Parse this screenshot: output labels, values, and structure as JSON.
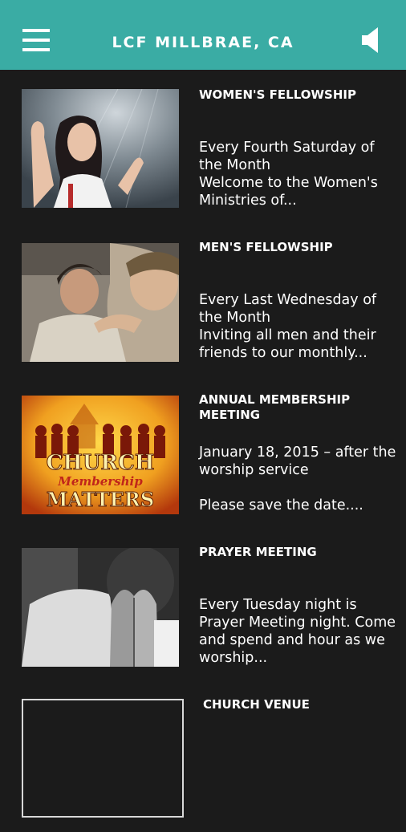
{
  "header": {
    "title": "LCF MILLBRAE, CA",
    "menu_icon": "hamburger-menu-icon",
    "sound_icon": "speaker-icon",
    "background_color": "#3aaca4"
  },
  "events": [
    {
      "title": "WOMEN'S FELLOWSHIP",
      "description": "Every Fourth Saturday of the Month\nWelcome to the Women's Ministries of..."
    },
    {
      "title": "MEN'S FELLOWSHIP",
      "description": "Every Last Wednesday of the Month\nInviting all men and their friends to our monthly..."
    },
    {
      "title": "ANNUAL MEMBERSHIP MEETING",
      "description": "January 18, 2015 – after the worship service\n\nPlease save the date....",
      "image_text": [
        "CHURCH",
        "Membership",
        "MATTERS"
      ]
    },
    {
      "title": "PRAYER MEETING",
      "description": "Every Tuesday night is Prayer Meeting night. Come and spend and hour as we worship..."
    },
    {
      "title": "CHURCH VENUE",
      "description": ""
    }
  ]
}
